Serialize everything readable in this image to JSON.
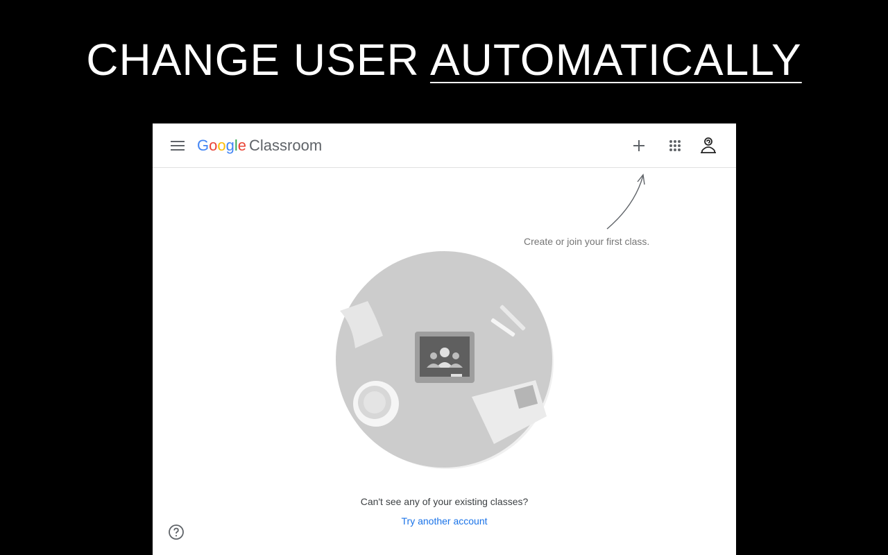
{
  "headline": {
    "part1": "CHANGE USER ",
    "part2": "AUTOMATICALLY"
  },
  "app": {
    "logo_letters": [
      "G",
      "o",
      "o",
      "g",
      "l",
      "e"
    ],
    "product": "Classroom",
    "icons": {
      "menu": "menu-icon",
      "add": "plus-icon",
      "apps": "apps-grid-icon",
      "account": "account-icon",
      "help": "help-icon"
    }
  },
  "main": {
    "hint": "Create or join your first class.",
    "cant_see": "Can't see any of your existing classes?",
    "try_another": "Try another account"
  },
  "colors": {
    "link": "#1a73e8",
    "google_blue": "#4285f4",
    "google_red": "#ea4335",
    "google_yellow": "#fbbc05",
    "google_green": "#34a853"
  }
}
